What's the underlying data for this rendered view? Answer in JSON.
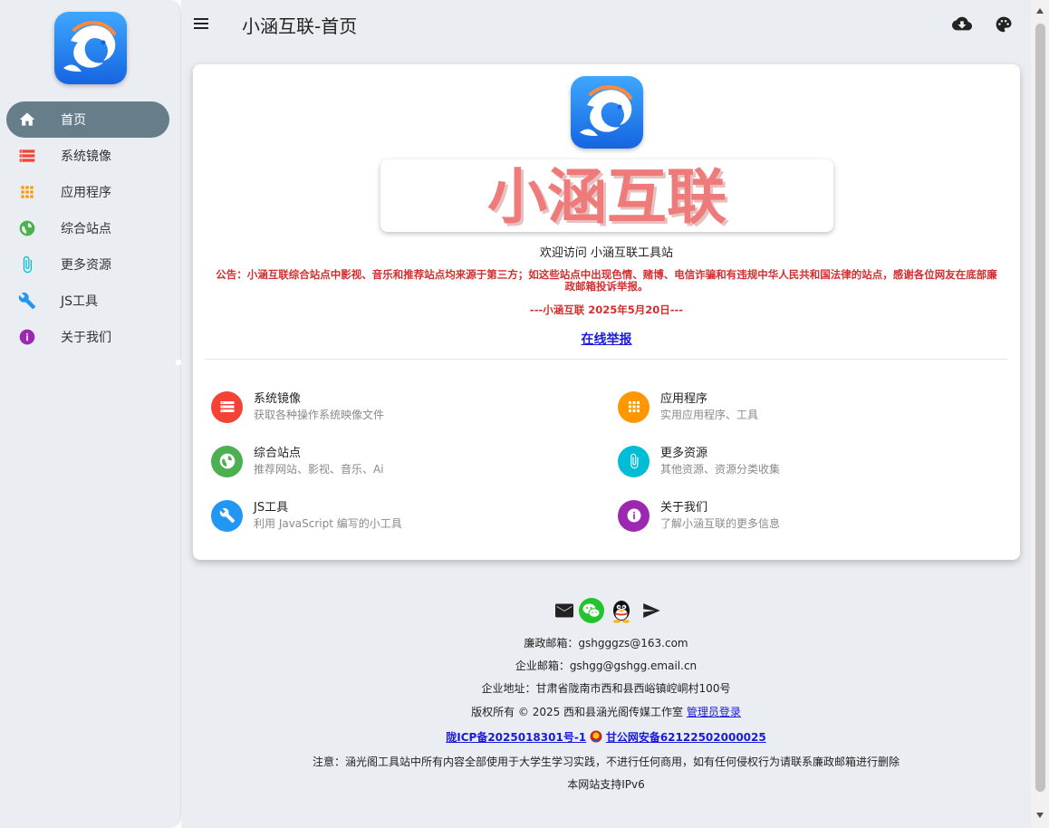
{
  "header": {
    "title": "小涵互联-首页"
  },
  "sidebar": {
    "items": [
      {
        "label": "首页",
        "icon": "home-icon"
      },
      {
        "label": "系统镜像",
        "icon": "storage-icon"
      },
      {
        "label": "应用程序",
        "icon": "apps-grid-icon"
      },
      {
        "label": "综合站点",
        "icon": "globe-icon"
      },
      {
        "label": "更多资源",
        "icon": "paperclip-icon"
      },
      {
        "label": "JS工具",
        "icon": "wrench-icon"
      },
      {
        "label": "关于我们",
        "icon": "info-icon"
      }
    ]
  },
  "main": {
    "banner_text": "小涵互联",
    "welcome": "欢迎访问 小涵互联工具站",
    "notice": "公告：小涵互联综合站点中影视、音乐和推荐站点均来源于第三方；如这些站点中出现色情、赌博、电信诈骗和有违规中华人民共和国法律的站点，感谢各位网友在底部廉政邮箱投诉举报。",
    "signature": "---小涵互联 2025年5月20日---",
    "report_link": "在线举报",
    "features": [
      {
        "title": "系统镜像",
        "subtitle": "获取各种操作系统映像文件",
        "color": "#f44336",
        "icon": "storage-icon"
      },
      {
        "title": "应用程序",
        "subtitle": "实用应用程序、工具",
        "color": "#ff9800",
        "icon": "apps-grid-icon"
      },
      {
        "title": "综合站点",
        "subtitle": "推荐网站、影视、音乐、Ai",
        "color": "#4caf50",
        "icon": "globe-icon"
      },
      {
        "title": "更多资源",
        "subtitle": "其他资源、资源分类收集",
        "color": "#00bcd4",
        "icon": "paperclip-icon"
      },
      {
        "title": "JS工具",
        "subtitle": "利用 JavaScript 编写的小工具",
        "color": "#2196f3",
        "icon": "wrench-icon"
      },
      {
        "title": "关于我们",
        "subtitle": "了解小涵互联的更多信息",
        "color": "#9c27b0",
        "icon": "info-icon"
      }
    ]
  },
  "footer": {
    "clean_email": "廉政邮箱：gshgggzs@163.com",
    "company_email": "企业邮箱：gshgg@gshgg.email.cn",
    "address": "企业地址：甘肃省陇南市西和县西峪镇崆峒村100号",
    "copyright": "版权所有 © 2025 西和县涵光阁传媒工作室",
    "admin_login": "管理员登录",
    "icp": "陇ICP备2025018301号-1",
    "police": "甘公网安备62122502000025",
    "disclaimer": "注意：涵光阁工具站中所有内容全部使用于大学生学习实践，不进行任何商用，如有任何侵权行为请联系廉政邮箱进行删除",
    "ipv6": "本网站支持IPv6"
  },
  "colors": {
    "sidebar_bg": "#eaedf1",
    "active_item": "#667d8a",
    "notice_red": "#d32f2f",
    "link_blue": "#1a1adb",
    "banner_text": "#ee7a7a"
  }
}
